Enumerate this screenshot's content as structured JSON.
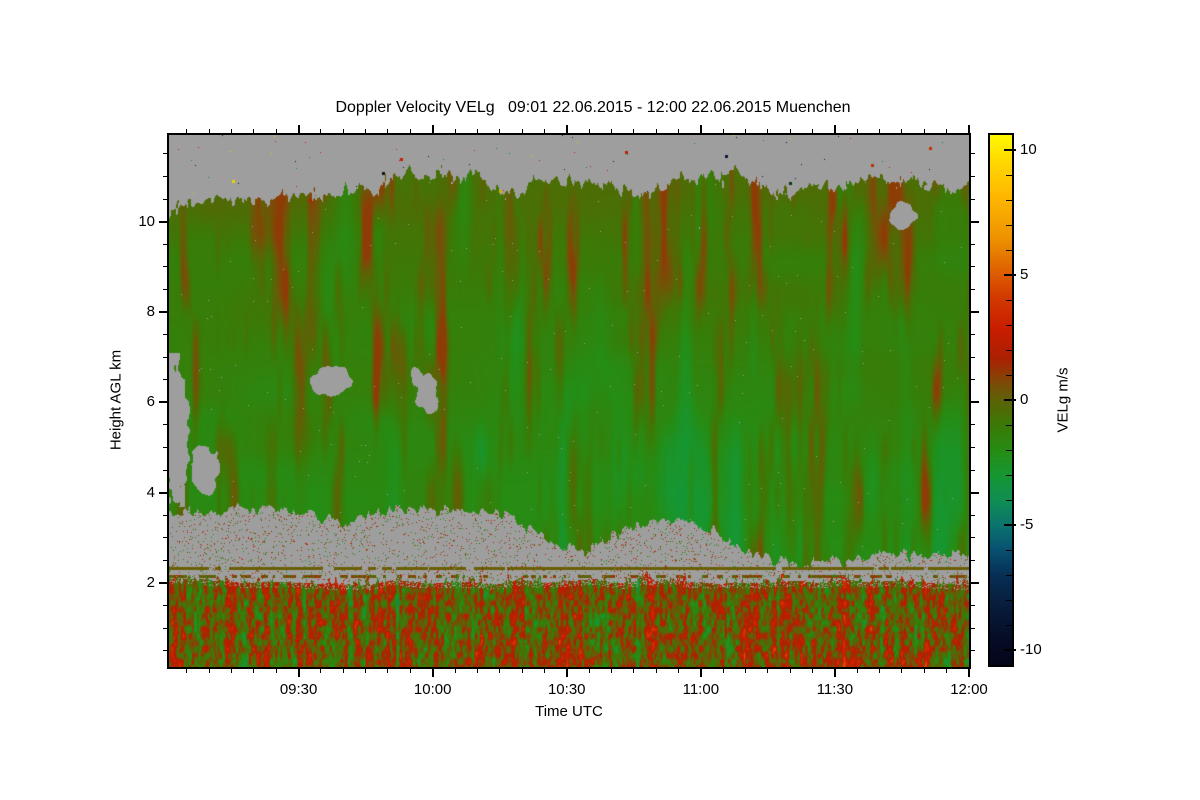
{
  "page": {
    "background": "#FFFFFF",
    "text_color": "#000000"
  },
  "chart_data": {
    "type": "heatmap",
    "title": "Doppler Velocity VELg   09:01 22.06.2015 - 12:00 22.06.2015 Muenchen",
    "instrument_variable": "VELg",
    "site": "Muenchen",
    "time_span": {
      "start": "09:01 22.06.2015",
      "end": "12:00 22.06.2015"
    },
    "xlabel": "Time UTC",
    "ylabel": "Height AGL km",
    "x_start": "09:01",
    "x_end": "12:00",
    "x_ticks": [
      "09:30",
      "10:00",
      "10:30",
      "11:00",
      "11:30",
      "12:00"
    ],
    "x_minor_step_minutes": 5,
    "y_ticks": [
      2,
      4,
      6,
      8,
      10
    ],
    "y_minor_step_km": 0.5,
    "y_range_km": [
      0.14,
      11.92
    ],
    "grid_lines": "off",
    "no_data_color": "#9E9E9E",
    "colorbar": {
      "label": "VELg m/s",
      "ticks": [
        -10,
        -5,
        0,
        5,
        10
      ],
      "minor_step": 1,
      "range": [
        -10.6,
        10.6
      ],
      "position": "right",
      "colormap_stops": [
        [
          -10.6,
          "#04061A"
        ],
        [
          -9.5,
          "#060D26"
        ],
        [
          -8,
          "#07203F"
        ],
        [
          -7,
          "#072F55"
        ],
        [
          -6,
          "#085070"
        ],
        [
          -5,
          "#0B736E"
        ],
        [
          -4,
          "#0F8E53"
        ],
        [
          -3,
          "#169732"
        ],
        [
          -2,
          "#268C14"
        ],
        [
          -1,
          "#3B7A07"
        ],
        [
          -0.4,
          "#4E6C05"
        ],
        [
          0,
          "#5C6306"
        ],
        [
          0.5,
          "#745207"
        ],
        [
          1,
          "#8C3E05"
        ],
        [
          1.7,
          "#AC2002"
        ],
        [
          2.8,
          "#C81C00"
        ],
        [
          4.2,
          "#D33C00"
        ],
        [
          6.5,
          "#EE9300"
        ],
        [
          8.2,
          "#FFB800"
        ],
        [
          9.6,
          "#FFDA00"
        ],
        [
          10.6,
          "#FFF800"
        ]
      ]
    },
    "grid": {
      "times": [
        "09:00",
        "09:15",
        "09:30",
        "09:45",
        "10:00",
        "10:15",
        "10:30",
        "10:45",
        "11:00",
        "11:15",
        "11:30",
        "11:45",
        "12:00"
      ],
      "heights_km": [
        0.5,
        1,
        1.5,
        2,
        2.5,
        3,
        3.5,
        4,
        5,
        6,
        7,
        8,
        9,
        10,
        10.5,
        11,
        11.5
      ],
      "values_mps": [
        [
          0.5,
          -0.3,
          0.6,
          0.8,
          -0.5,
          0.7,
          0.4,
          -0.6,
          0.8,
          0.5,
          -0.3,
          0.7,
          0.5
        ],
        [
          0.4,
          0.7,
          -0.6,
          0.5,
          0.9,
          -0.4,
          0.6,
          0.8,
          -0.5,
          0.7,
          0.5,
          0.9,
          0.6
        ],
        [
          0.6,
          -0.5,
          0.8,
          0.4,
          -0.6,
          0.9,
          0.5,
          -0.3,
          0.7,
          0.4,
          0.8,
          -0.4,
          0.6
        ],
        [
          0.3,
          0.5,
          -0.2,
          0.4,
          0.6,
          -0.3,
          0.5,
          0.2,
          -0.4,
          0.6,
          0.3,
          0.5,
          0.4
        ],
        [
          null,
          null,
          null,
          null,
          null,
          null,
          null,
          null,
          null,
          null,
          null,
          null,
          null
        ],
        [
          null,
          null,
          null,
          null,
          null,
          null,
          null,
          -2.4,
          -2.5,
          -2.4,
          -2.6,
          -2.5,
          -2.4
        ],
        [
          null,
          null,
          -1.9,
          -2.0,
          -2.1,
          -2.0,
          -2.2,
          -2.1,
          -2.3,
          -2.2,
          -2.4,
          -2.3,
          -2.2
        ],
        [
          null,
          -1.8,
          -1.7,
          -1.9,
          -2.0,
          -1.9,
          -2.1,
          -2.0,
          -2.2,
          -2.1,
          -2.2,
          -2.1,
          -2.0
        ],
        [
          -1.6,
          -1.5,
          -1.7,
          -1.6,
          -1.8,
          -1.7,
          -1.9,
          -1.8,
          -1.9,
          -2.0,
          -1.8,
          -1.9,
          -1.8
        ],
        [
          null,
          -1.5,
          -1.6,
          -1.5,
          -1.7,
          -1.6,
          -1.8,
          -1.6,
          -1.7,
          -1.8,
          -1.6,
          -1.7,
          -1.6
        ],
        [
          -1.4,
          -1.3,
          -1.5,
          -1.4,
          -1.6,
          -1.5,
          -1.6,
          -1.5,
          -1.6,
          -1.5,
          -1.4,
          -1.5,
          -1.4
        ],
        [
          -1.2,
          -1.1,
          -1.3,
          -1.2,
          -1.4,
          -1.3,
          -1.4,
          -1.3,
          -1.4,
          -1.3,
          -1.2,
          -1.3,
          -1.2
        ],
        [
          -0.8,
          -0.9,
          -1.0,
          -0.9,
          -1.1,
          -1.0,
          -1.2,
          -1.0,
          -1.1,
          -1.0,
          -1.1,
          -1.0,
          -0.9
        ],
        [
          null,
          -0.5,
          -0.6,
          -0.5,
          -0.6,
          -0.7,
          -0.6,
          -0.7,
          -0.6,
          -0.7,
          -0.6,
          -0.6,
          -0.5
        ],
        [
          null,
          null,
          null,
          null,
          -0.3,
          -0.3,
          null,
          -0.4,
          -0.3,
          -0.4,
          -0.3,
          -0.4,
          -0.3
        ],
        [
          null,
          null,
          null,
          null,
          null,
          null,
          null,
          null,
          null,
          null,
          null,
          null,
          null
        ],
        [
          null,
          null,
          null,
          null,
          null,
          null,
          null,
          null,
          null,
          null,
          null,
          null,
          null
        ]
      ]
    },
    "features": [
      "gray pixels = no valid signal (clear air / clutter)",
      "solid gray above cloud top near 10.8-11 km up to plot top",
      "gray no-signal layer between about 2.1 and 3.6 km, thinning toward 12:00",
      "boundary layer below about 2 km: speckled alternating updrafts (red, +1 to +4 m/s) and downdrafts (green)",
      "3.5-11 km: weak downward motion (green, about -1 to -2.5 m/s) with brownish-orange vertical updraft streaks",
      "thin intermittent olive line near 2.3 km inside the gray layer",
      "isolated gray gaps near 09:35 at 6.3 km and near 11:45 at 10.2 km"
    ]
  }
}
